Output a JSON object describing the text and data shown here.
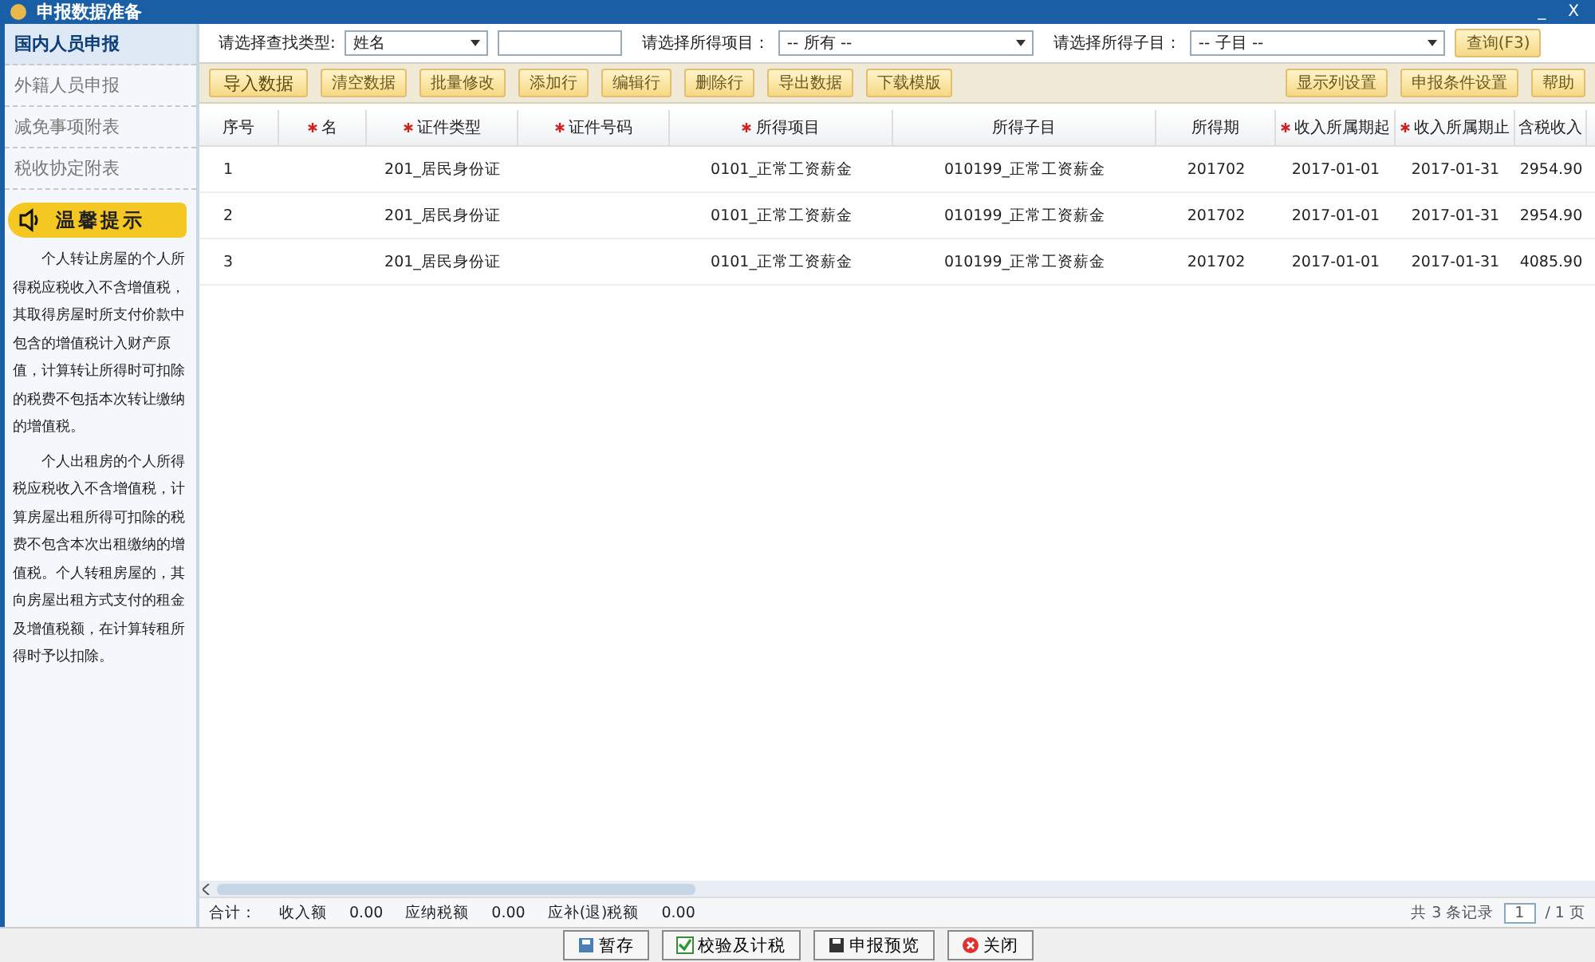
{
  "window": {
    "title": "申报数据准备",
    "buttons": [
      "_",
      "X"
    ]
  },
  "sidebar": {
    "items": [
      {
        "label": "国内人员申报",
        "selected": true
      },
      {
        "label": "外籍人员申报",
        "selected": false
      },
      {
        "label": "减免事项附表",
        "selected": false
      },
      {
        "label": "税收协定附表",
        "selected": false
      }
    ],
    "tips": {
      "title": "温馨提示",
      "paragraphs": [
        "个人转让房屋的个人所得税应税收入不含增值税，其取得房屋时所支付价款中包含的增值税计入财产原值，计算转让所得时可扣除的税费不包括本次转让缴纳的增值税。",
        "个人出租房的个人所得税应税收入不含增值税，计算房屋出租所得可扣除的税费不包含本次出租缴纳的增值税。个人转租房屋的，其向房屋出租方式支付的租金及增值税额，在计算转租所得时予以扣除。"
      ]
    }
  },
  "filters": [
    {
      "label": "请选择查找类型:",
      "value": "姓名",
      "kind": "select"
    },
    {
      "kind": "input"
    },
    {
      "label": "请选择所得项目：",
      "value": "-- 所有 --",
      "kind": "select"
    },
    {
      "label": "请选择所得子目：",
      "value": "-- 子目 --",
      "kind": "select"
    }
  ],
  "query_button": "查询(F3)",
  "toolbar": {
    "left": [
      "导入数据",
      "清空数据",
      "批量修改",
      "添加行",
      "编辑行",
      "删除行",
      "导出数据",
      "下载模版"
    ],
    "right": [
      "显示列设置",
      "申报条件设置",
      "帮助"
    ]
  },
  "table": {
    "columns": [
      {
        "label": "序号",
        "required": false
      },
      {
        "label": "名",
        "required": true
      },
      {
        "label": "证件类型",
        "required": true
      },
      {
        "label": "证件号码",
        "required": true
      },
      {
        "label": "所得项目",
        "required": true
      },
      {
        "label": "所得子目",
        "required": false
      },
      {
        "label": "所得期",
        "required": false
      },
      {
        "label": "收入所属期起",
        "required": true
      },
      {
        "label": "收入所属期止",
        "required": true
      },
      {
        "label": "含税收入",
        "required": false
      }
    ],
    "rows": [
      [
        "1",
        "",
        "201_居民身份证",
        "",
        "0101_正常工资薪金",
        "010199_正常工资薪金",
        "201702",
        "2017-01-01",
        "2017-01-31",
        "2954.90"
      ],
      [
        "2",
        "",
        "201_居民身份证",
        "",
        "0101_正常工资薪金",
        "010199_正常工资薪金",
        "201702",
        "2017-01-01",
        "2017-01-31",
        "2954.90"
      ],
      [
        "3",
        "",
        "201_居民身份证",
        "",
        "0101_正常工资薪金",
        "010199_正常工资薪金",
        "201702",
        "2017-01-01",
        "2017-01-31",
        "4085.90"
      ]
    ]
  },
  "totals": [
    {
      "label": "合计："
    },
    {
      "label": "收入额",
      "value": "0.00"
    },
    {
      "label": "应纳税额",
      "value": "0.00"
    },
    {
      "label": "应补(退)税额",
      "value": "0.00"
    }
  ],
  "pager": {
    "summary": "共 3 条记录",
    "page": "1",
    "pages": "/ 1 页"
  },
  "actions": [
    "暂存",
    "校验及计税",
    "申报预览",
    "关闭"
  ]
}
